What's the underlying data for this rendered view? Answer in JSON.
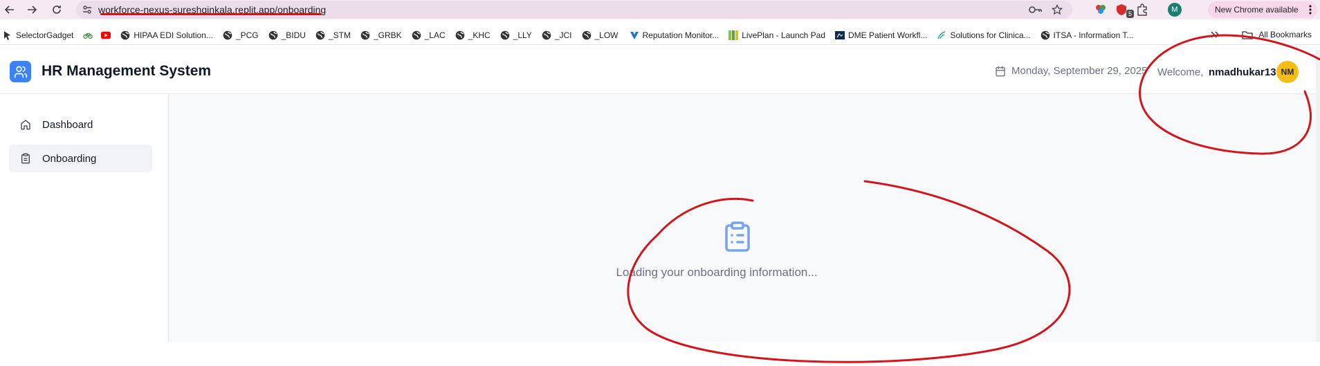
{
  "browser": {
    "url": "workforce-nexus-sureshqinkala.replit.app/onboarding",
    "new_chrome_label": "New Chrome available",
    "profile_initial": "M",
    "extension_badge": "5"
  },
  "bookmarks": {
    "items": [
      {
        "label": "SelectorGadget",
        "icon": "selector-icon"
      },
      {
        "label": "",
        "icon": "bicycle-icon"
      },
      {
        "label": "",
        "icon": "youtube-icon"
      },
      {
        "label": "HIPAA EDI Solution...",
        "icon": "globe-icon"
      },
      {
        "label": "_PCG",
        "icon": "globe-icon"
      },
      {
        "label": "_BIDU",
        "icon": "globe-icon"
      },
      {
        "label": "_STM",
        "icon": "globe-icon"
      },
      {
        "label": "_GRBK",
        "icon": "globe-icon"
      },
      {
        "label": "_LAC",
        "icon": "globe-icon"
      },
      {
        "label": "_KHC",
        "icon": "globe-icon"
      },
      {
        "label": "_LLY",
        "icon": "globe-icon"
      },
      {
        "label": "_JCI",
        "icon": "globe-icon"
      },
      {
        "label": "_LOW",
        "icon": "globe-icon"
      },
      {
        "label": "Reputation Monitor...",
        "icon": "reputation-icon"
      },
      {
        "label": "LivePlan - Launch Pad",
        "icon": "liveplan-icon"
      },
      {
        "label": "DME Patient Workfl...",
        "icon": "dme-icon"
      },
      {
        "label": "Solutions for Clinica...",
        "icon": "solutions-icon"
      },
      {
        "label": "ITSA - Information T...",
        "icon": "globe-icon"
      }
    ],
    "all_bookmarks_label": "All Bookmarks"
  },
  "header": {
    "title": "HR Management System",
    "date": "Monday, September 29, 2025",
    "welcome_label": "Welcome,",
    "username": "nmadhukar13",
    "avatar_initials": "NM"
  },
  "sidebar": {
    "items": [
      {
        "label": "Dashboard",
        "icon": "home-icon",
        "active": false
      },
      {
        "label": "Onboarding",
        "icon": "clipboard-icon",
        "active": true
      }
    ]
  },
  "main": {
    "loading_text": "Loading your onboarding information...",
    "loading_icon": "clipboard-list-icon"
  },
  "colors": {
    "accent": "#3b82f6",
    "avatar": "#f6bd16",
    "annotation": "#d3141b"
  }
}
